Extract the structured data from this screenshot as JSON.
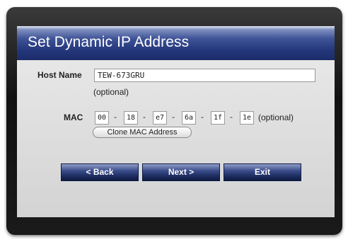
{
  "dialog": {
    "title": "Set Dynamic IP Address"
  },
  "host": {
    "label": "Host Name",
    "value": "TEW-673GRU",
    "note": "(optional)"
  },
  "mac": {
    "label": "MAC",
    "fields": [
      "00",
      "18",
      "e7",
      "6a",
      "1f",
      "1e"
    ],
    "separator": "-",
    "note": "(optional)",
    "clone_label": "Clone MAC Address"
  },
  "buttons": {
    "back": "< Back",
    "next": "Next >",
    "exit": "Exit"
  },
  "colors": {
    "header": "#23367a",
    "panel": "#dcdcdc",
    "frame": "#1a1a1a",
    "button": "#1c2b5e"
  }
}
